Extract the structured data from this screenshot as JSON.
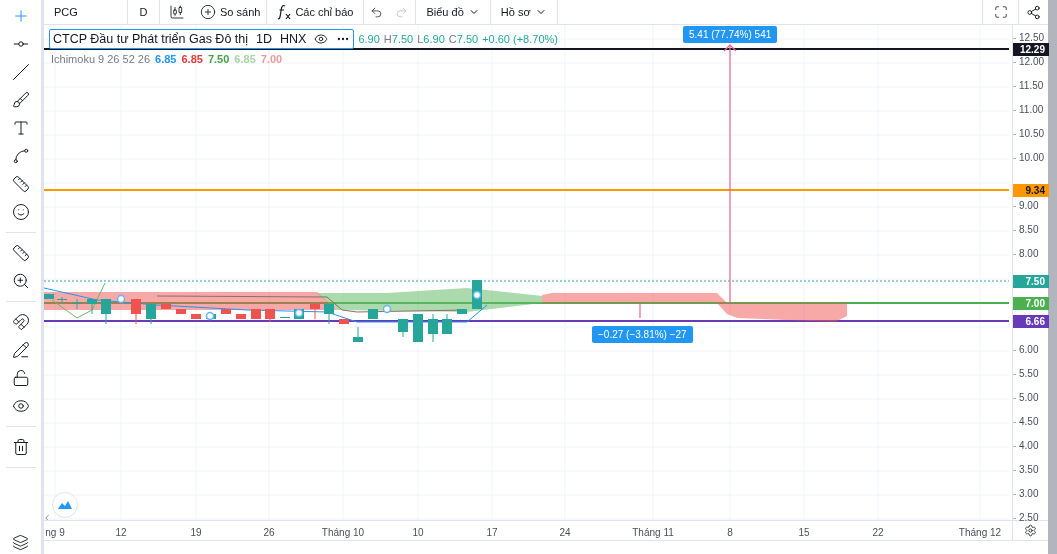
{
  "toolbar": {
    "symbol": "PCG",
    "interval": "D",
    "compare": "So sánh",
    "indicators": "Các chỉ báo",
    "chart_menu": "Biểu đồ",
    "profile_menu": "Hồ sơ"
  },
  "legend": {
    "title": "CTCP Đầu tư Phát triển Gas Đô thị",
    "interval": "1D",
    "exchange": "HNX",
    "ohlc": [
      {
        "value": "6.90"
      },
      {
        "label": "H",
        "value": "7.50"
      },
      {
        "label": "L",
        "value": "6.90"
      },
      {
        "label": "C",
        "value": "7.50"
      }
    ],
    "change": "+0.60 (+8.70%)"
  },
  "indicator": {
    "name": "Ichimoku 9 26 52 26",
    "values": [
      {
        "value": "6.85",
        "color": "#2196f3"
      },
      {
        "value": "6.85",
        "color": "#e53935"
      },
      {
        "value": "7.50",
        "color": "#43a047"
      },
      {
        "value": "6.85",
        "color": "#a5d6a7"
      },
      {
        "value": "7.00",
        "color": "#ef9a9a"
      }
    ]
  },
  "measurements": [
    {
      "text": "5.41 (77.74%) 541"
    },
    {
      "text": "−0.27 (−3.81%) −27"
    }
  ],
  "price_axis": {
    "labels": [
      "12.50",
      "12.00",
      "11.50",
      "11.00",
      "10.50",
      "10.00",
      "9.00",
      "8.50",
      "8.00",
      "6.00",
      "5.50",
      "5.00",
      "4.50",
      "4.00",
      "3.50",
      "3.00",
      "2.50"
    ]
  },
  "price_lines": [
    {
      "label": "12.29",
      "color": "#131722"
    },
    {
      "label": "9.34",
      "color": "#ff9800"
    },
    {
      "label": "7.50",
      "color": "#26a69a"
    },
    {
      "label": "7.00",
      "color": "#4caf50"
    },
    {
      "label": "6.66",
      "color": "#673ab7"
    }
  ],
  "time_axis": {
    "labels": [
      "ng 9",
      "12",
      "19",
      "26",
      "Tháng 10",
      "10",
      "17",
      "24",
      "Tháng 11",
      "8",
      "15",
      "22",
      "Tháng 12"
    ]
  }
}
